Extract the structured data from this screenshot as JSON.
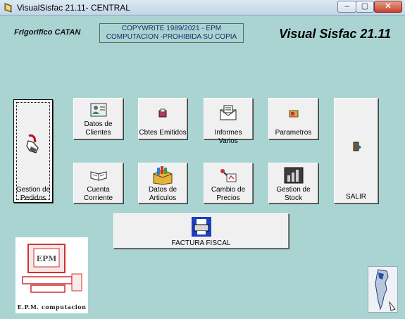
{
  "window": {
    "title": "VisualSisfac 21.11- CENTRAL",
    "controls": {
      "minimize": "–",
      "maximize": "▢",
      "close": "✕"
    }
  },
  "header": {
    "company": "Frigorifico CATAN",
    "copyright_line1": "COPYWRITE 1989/2021 - EPM",
    "copyright_line2": "COMPUTACION -PROHIBIDA SU COPIA",
    "app_name": "Visual Sisfac 21.11"
  },
  "buttons": {
    "gestion_pedidos": "Gestion de Pedidos",
    "datos_clientes": "Datos de Clientes",
    "cbtes_emitidos": "Cbtes Emitidos",
    "informes_varios": "Informes Varios",
    "parametros": "Parametros",
    "salir": "SALIR",
    "cuenta_corriente": "Cuenta Corriente",
    "datos_articulos": "Datos de Articulos",
    "cambio_precios": "Cambio de Precios",
    "gestion_stock": "Gestion de Stock",
    "factura_fiscal": "FACTURA FISCAL"
  },
  "logo": {
    "caption": "E.P.M. computacion",
    "screen_text": "EPM"
  }
}
